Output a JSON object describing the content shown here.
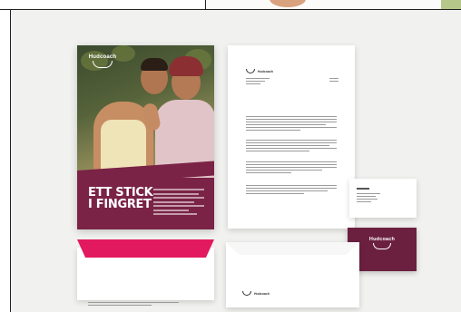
{
  "poster": {
    "brand": "Hudcoach",
    "headline_line1": "ETT STICK",
    "headline_line2": "I FINGRET"
  },
  "letterhead": {
    "brand": "Hudcoach"
  },
  "business_card": {
    "brand": "Hudcoach"
  },
  "envelope": {
    "brand": "Hudcoach"
  },
  "colors": {
    "plum": "#7a2346",
    "magenta": "#e2195f",
    "background": "#f1f1ef"
  }
}
